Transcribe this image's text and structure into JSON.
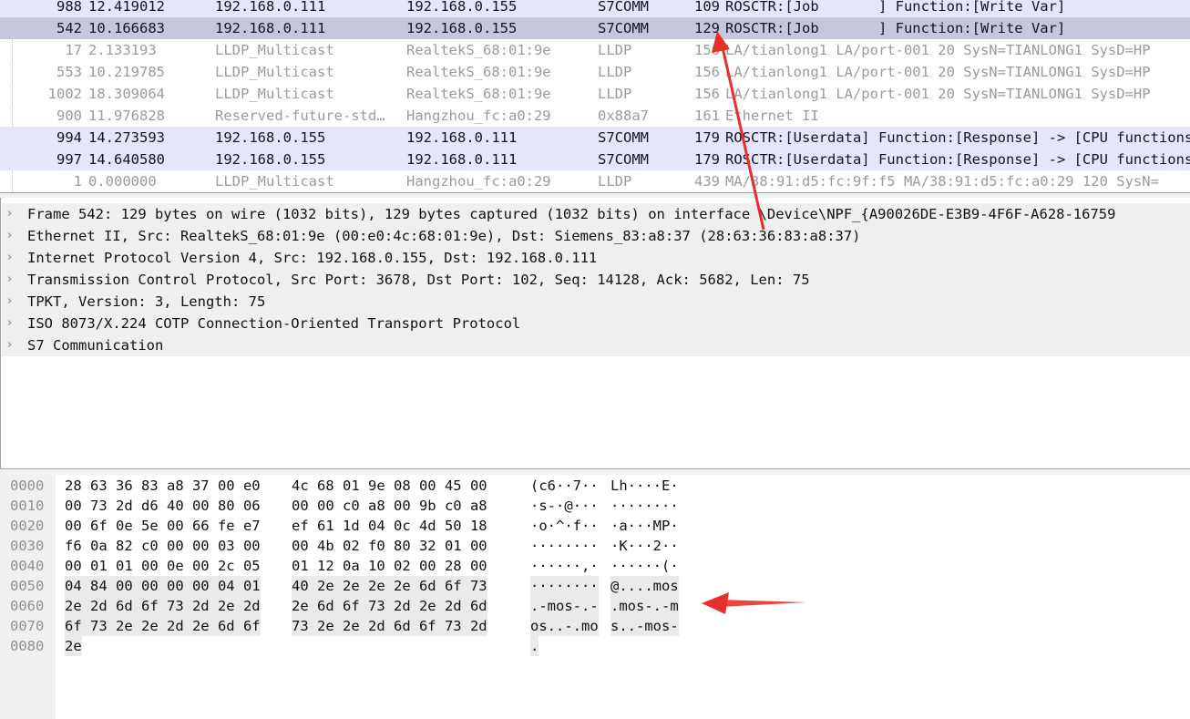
{
  "packet_list": {
    "rows": [
      {
        "no": "988",
        "time": "12.419012",
        "src": "192.168.0.111",
        "dst": "192.168.0.155",
        "proto": "S7COMM",
        "len": "109",
        "info": "ROSCTR:[Job       ] Function:[Write Var]",
        "kind": "s7",
        "selected": false
      },
      {
        "no": "542",
        "time": "10.166683",
        "src": "192.168.0.111",
        "dst": "192.168.0.155",
        "proto": "S7COMM",
        "len": "129",
        "info": "ROSCTR:[Job       ] Function:[Write Var]",
        "kind": "s7",
        "selected": true
      },
      {
        "no": "17",
        "time": "2.133193",
        "src": "LLDP_Multicast",
        "dst": "RealtekS_68:01:9e",
        "proto": "LLDP",
        "len": "156",
        "info": "LA/tianlong1 LA/port-001 20 SysN=TIANLONG1 SysD=HP",
        "kind": "lldp",
        "selected": false
      },
      {
        "no": "553",
        "time": "10.219785",
        "src": "LLDP_Multicast",
        "dst": "RealtekS_68:01:9e",
        "proto": "LLDP",
        "len": "156",
        "info": "LA/tianlong1 LA/port-001 20 SysN=TIANLONG1 SysD=HP",
        "kind": "lldp",
        "selected": false
      },
      {
        "no": "1002",
        "time": "18.309064",
        "src": "LLDP_Multicast",
        "dst": "RealtekS_68:01:9e",
        "proto": "LLDP",
        "len": "156",
        "info": "LA/tianlong1 LA/port-001 20 SysN=TIANLONG1 SysD=HP",
        "kind": "lldp",
        "selected": false
      },
      {
        "no": "900",
        "time": "11.976828",
        "src": "Reserved-future-std…",
        "dst": "Hangzhou_fc:a0:29",
        "proto": "0x88a7",
        "len": "161",
        "info": "Ethernet II",
        "kind": "lldp",
        "selected": false
      },
      {
        "no": "994",
        "time": "14.273593",
        "src": "192.168.0.155",
        "dst": "192.168.0.111",
        "proto": "S7COMM",
        "len": "179",
        "info": "ROSCTR:[Userdata] Function:[Response] -> [CPU functions]",
        "kind": "s7",
        "selected": false
      },
      {
        "no": "997",
        "time": "14.640580",
        "src": "192.168.0.155",
        "dst": "192.168.0.111",
        "proto": "S7COMM",
        "len": "179",
        "info": "ROSCTR:[Userdata] Function:[Response] -> [CPU functions]",
        "kind": "s7",
        "selected": false
      },
      {
        "no": "1",
        "time": "0.000000",
        "src": "LLDP_Multicast",
        "dst": "Hangzhou_fc:a0:29",
        "proto": "LLDP",
        "len": "439",
        "info": "MA/38:91:d5:fc:9f:f5 MA/38:91:d5:fc:a0:29 120 SysN=",
        "kind": "lldp",
        "selected": false
      }
    ]
  },
  "details": {
    "rows": [
      "Frame 542: 129 bytes on wire (1032 bits), 129 bytes captured (1032 bits) on interface \\Device\\NPF_{A90026DE-E3B9-4F6F-A628-16759",
      "Ethernet II, Src: RealtekS_68:01:9e (00:e0:4c:68:01:9e), Dst: Siemens_83:a8:37 (28:63:36:83:a8:37)",
      "Internet Protocol Version 4, Src: 192.168.0.155, Dst: 192.168.0.111",
      "Transmission Control Protocol, Src Port: 3678, Dst Port: 102, Seq: 14128, Ack: 5682, Len: 75",
      "TPKT, Version: 3, Length: 75",
      "ISO 8073/X.224 COTP Connection-Oriented Transport Protocol",
      "S7 Communication"
    ],
    "expander_glyph": "›"
  },
  "bytes": {
    "rows": [
      {
        "off": "0000",
        "hex1": "28 63 36 83 a8 37 00 e0",
        "hex2": "4c 68 01 9e 08 00 45 00",
        "asc1": "(c6··7··",
        "asc2": "Lh····E·"
      },
      {
        "off": "0010",
        "hex1": "00 73 2d d6 40 00 80 06",
        "hex2": "00 00 c0 a8 00 9b c0 a8",
        "asc1": "·s-·@···",
        "asc2": "········"
      },
      {
        "off": "0020",
        "hex1": "00 6f 0e 5e 00 66 fe e7",
        "hex2": "ef 61 1d 04 0c 4d 50 18",
        "asc1": "·o·^·f··",
        "asc2": "·a···MP·"
      },
      {
        "off": "0030",
        "hex1": "f6 0a 82 c0 00 00 03 00",
        "hex2": "00 4b 02 f0 80 32 01 00",
        "asc1": "········",
        "asc2": "·K···2··"
      },
      {
        "off": "0040",
        "hex1": "00 01 01 00 0e 00 2c 05",
        "hex2": "01 12 0a 10 02 00 28 00",
        "asc1": "······,·",
        "asc2": "······(·"
      },
      {
        "off": "0050",
        "hex1": "04 84 00 00 00 00 04 01",
        "hex2": "40 2e 2e 2e 2e 6d 6f 73",
        "asc1": "········",
        "asc2": "@....mos"
      },
      {
        "off": "0060",
        "hex1": "2e 2d 6d 6f 73 2d 2e 2d",
        "hex2": "2e 6d 6f 73 2d 2e 2d 6d",
        "asc1": ".-mos-.-",
        "asc2": ".mos-.-m"
      },
      {
        "off": "0070",
        "hex1": "6f 73 2e 2e 2d 2e 6d 6f",
        "hex2": "73 2e 2e 2d 6d 6f 73 2d",
        "asc1": "os..-.mo",
        "asc2": "s..-mos-"
      },
      {
        "off": "0080",
        "hex1": "2e",
        "hex2": "",
        "asc1": ".",
        "asc2": ""
      }
    ]
  },
  "colors": {
    "s7_row": "#e6e6fb",
    "selected_row": "#c6c6dc",
    "lldp_text": "#9b9b9b",
    "arrow": "#e8302a"
  }
}
